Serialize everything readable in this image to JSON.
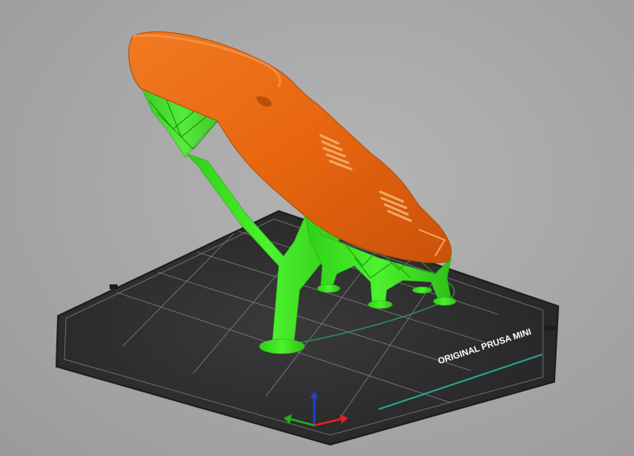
{
  "viewport": {
    "bed": {
      "label": "ORIGINAL PRUSA MINI",
      "surface_color": "#2b2b2b",
      "grid_color": "#8a8a8a",
      "label_color": "#ffffff"
    },
    "model": {
      "color": "#e8660f",
      "support_color": "#3fe224",
      "shadow_outline_color": "#2e8b57"
    },
    "axes": {
      "x_color": "#e02020",
      "y_color": "#20b020",
      "z_color": "#2040e0"
    }
  }
}
